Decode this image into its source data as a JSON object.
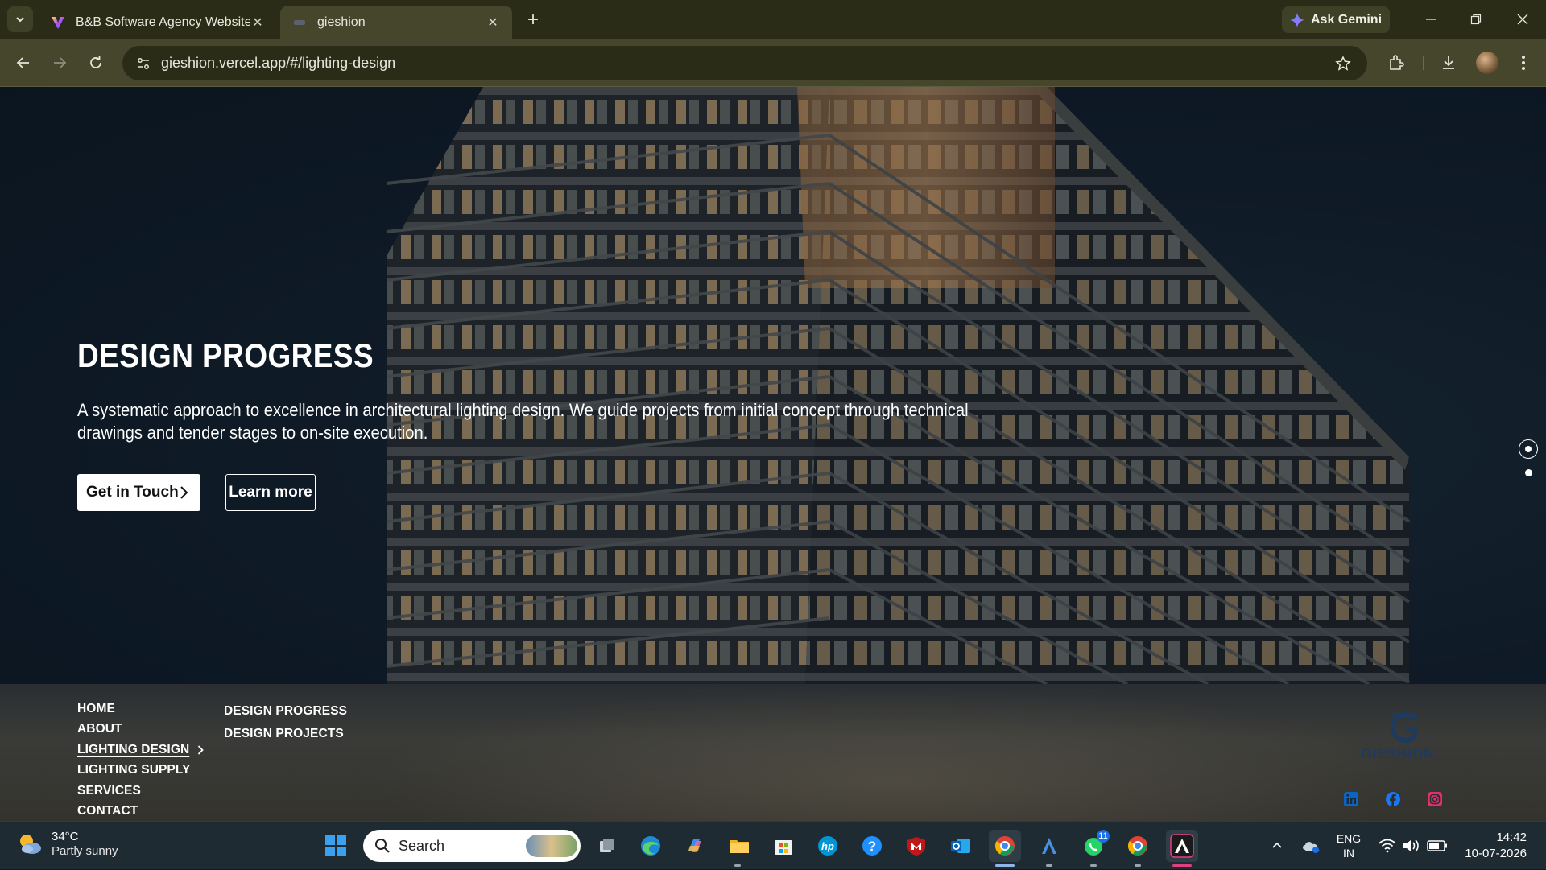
{
  "browser": {
    "tabs": [
      {
        "title": "B&B Software Agency Website",
        "active": false
      },
      {
        "title": "gieshion",
        "active": true
      }
    ],
    "gemini_label": "Ask Gemini",
    "url": "gieshion.vercel.app/#/lighting-design"
  },
  "hero": {
    "title": "DESIGN PROGRESS",
    "description": "A systematic approach to excellence in architectural lighting design. We guide projects from initial concept through technical drawings and tender stages to on-site execution.",
    "primary_button": "Get in Touch",
    "secondary_button": "Learn more",
    "slides": {
      "count": 2,
      "active_index": 0
    }
  },
  "footer": {
    "nav": [
      {
        "label": "HOME",
        "active": false
      },
      {
        "label": "ABOUT",
        "active": false
      },
      {
        "label": "LIGHTING DESIGN",
        "active": true
      },
      {
        "label": "LIGHTING SUPPLY",
        "active": false
      },
      {
        "label": "SERVICES",
        "active": false
      },
      {
        "label": "CONTACT",
        "active": false
      }
    ],
    "subnav": [
      {
        "label": "DESIGN PROGRESS"
      },
      {
        "label": "DESIGN PROJECTS"
      }
    ],
    "logo_text": "GIESHION",
    "social": [
      "linkedin-icon",
      "facebook-icon",
      "instagram-icon"
    ],
    "colors": {
      "linkedin": "#0a66c2",
      "facebook": "#1877f2",
      "instagram": "#e1306c",
      "logo": "#1e3a5f"
    }
  },
  "taskbar": {
    "weather": {
      "temp": "34°C",
      "condition": "Partly sunny"
    },
    "search_placeholder": "Search",
    "whatsapp_badge": "11",
    "language": {
      "line1": "ENG",
      "line2": "IN"
    },
    "time": "14:42",
    "date": "10-07-2026"
  }
}
